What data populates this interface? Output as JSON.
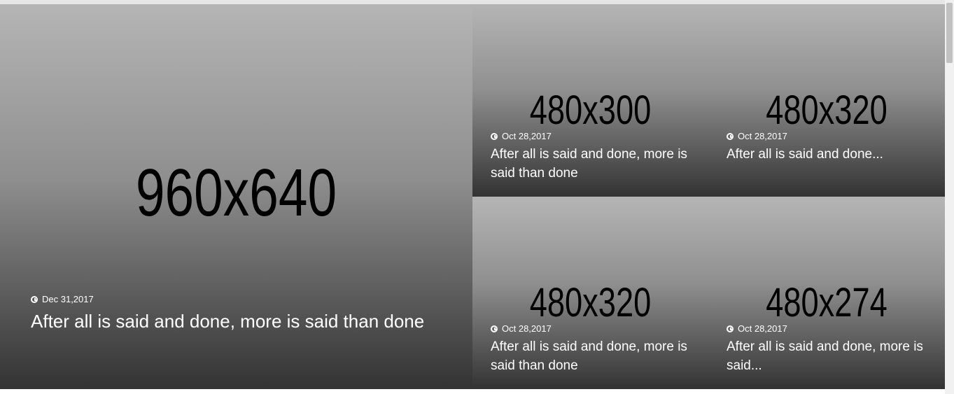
{
  "cards": [
    {
      "placeholder": "960x640",
      "date": "Dec 31,2017",
      "title": "After all is said and done, more is said than done"
    },
    {
      "placeholder": "480x300",
      "date": "Oct 28,2017",
      "title": "After all is said and done, more is said than done"
    },
    {
      "placeholder": "480x320",
      "date": "Oct 28,2017",
      "title": "After all is said and done..."
    },
    {
      "placeholder": "480x320",
      "date": "Oct 28,2017",
      "title": "After all is said and done, more is said than done"
    },
    {
      "placeholder": "480x274",
      "date": "Oct 28,2017",
      "title": "After all is said and done, more is said..."
    }
  ],
  "icons": {
    "date_icon": "clock-icon"
  }
}
